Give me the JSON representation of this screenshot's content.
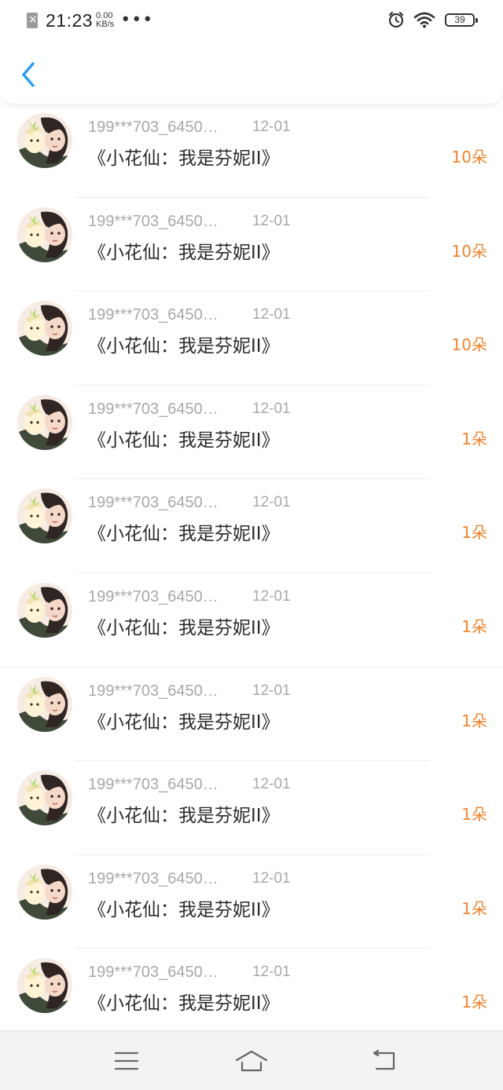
{
  "status_bar": {
    "time": "21:23",
    "speed_value": "0.00",
    "speed_unit": "KB/s",
    "dots": "•••",
    "battery": "39"
  },
  "header": {
    "back_icon": "chevron-left-icon"
  },
  "colors": {
    "accent_orange": "#f0832c",
    "back_blue": "#2a9df4",
    "meta_gray": "#a8a8a8"
  },
  "list": [
    {
      "user": "199***703_6450…",
      "date": "12-01",
      "title": "《小花仙：我是芬妮II》",
      "amount": "10朵"
    },
    {
      "user": "199***703_6450…",
      "date": "12-01",
      "title": "《小花仙：我是芬妮II》",
      "amount": "10朵"
    },
    {
      "user": "199***703_6450…",
      "date": "12-01",
      "title": "《小花仙：我是芬妮II》",
      "amount": "10朵"
    },
    {
      "user": "199***703_6450…",
      "date": "12-01",
      "title": "《小花仙：我是芬妮II》",
      "amount": "1朵"
    },
    {
      "user": "199***703_6450…",
      "date": "12-01",
      "title": "《小花仙：我是芬妮II》",
      "amount": "1朵"
    },
    {
      "user": "199***703_6450…",
      "date": "12-01",
      "title": "《小花仙：我是芬妮II》",
      "amount": "1朵"
    },
    {
      "user": "199***703_6450…",
      "date": "12-01",
      "title": "《小花仙：我是芬妮II》",
      "amount": "1朵"
    },
    {
      "user": "199***703_6450…",
      "date": "12-01",
      "title": "《小花仙：我是芬妮II》",
      "amount": "1朵"
    },
    {
      "user": "199***703_6450…",
      "date": "12-01",
      "title": "《小花仙：我是芬妮II》",
      "amount": "1朵"
    },
    {
      "user": "199***703_6450…",
      "date": "12-01",
      "title": "《小花仙：我是芬妮II》",
      "amount": "1朵"
    }
  ],
  "nav_bar": {
    "icons": [
      "menu-icon",
      "home-icon",
      "back-icon"
    ]
  }
}
